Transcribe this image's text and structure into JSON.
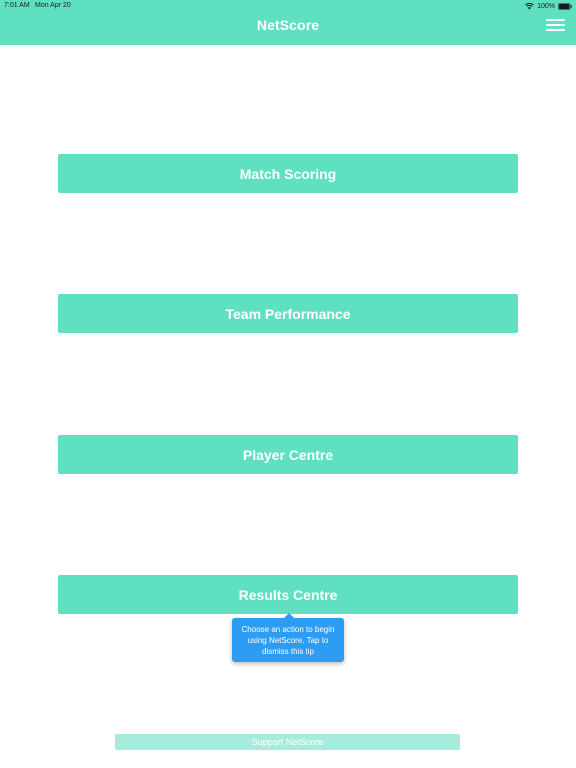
{
  "status_bar": {
    "time": "7:01 AM",
    "date": "Mon Apr 20",
    "battery": "100%",
    "icons": [
      "wifi-icon",
      "battery-icon"
    ]
  },
  "header": {
    "title": "NetScore",
    "menu_icon": "hamburger-menu-icon"
  },
  "actions": {
    "match_scoring": "Match Scoring",
    "team_performance": "Team Performance",
    "player_centre": "Player Centre",
    "results_centre": "Results Centre"
  },
  "tooltip": {
    "text": "Choose an action to begin using NetScore. Tap to dismiss this tip"
  },
  "footer": {
    "support_label": "Support NetScore"
  },
  "colors": {
    "accent": "#5fe0c0",
    "tooltip": "#2c9df2",
    "support_button": "#a6ecdc"
  }
}
